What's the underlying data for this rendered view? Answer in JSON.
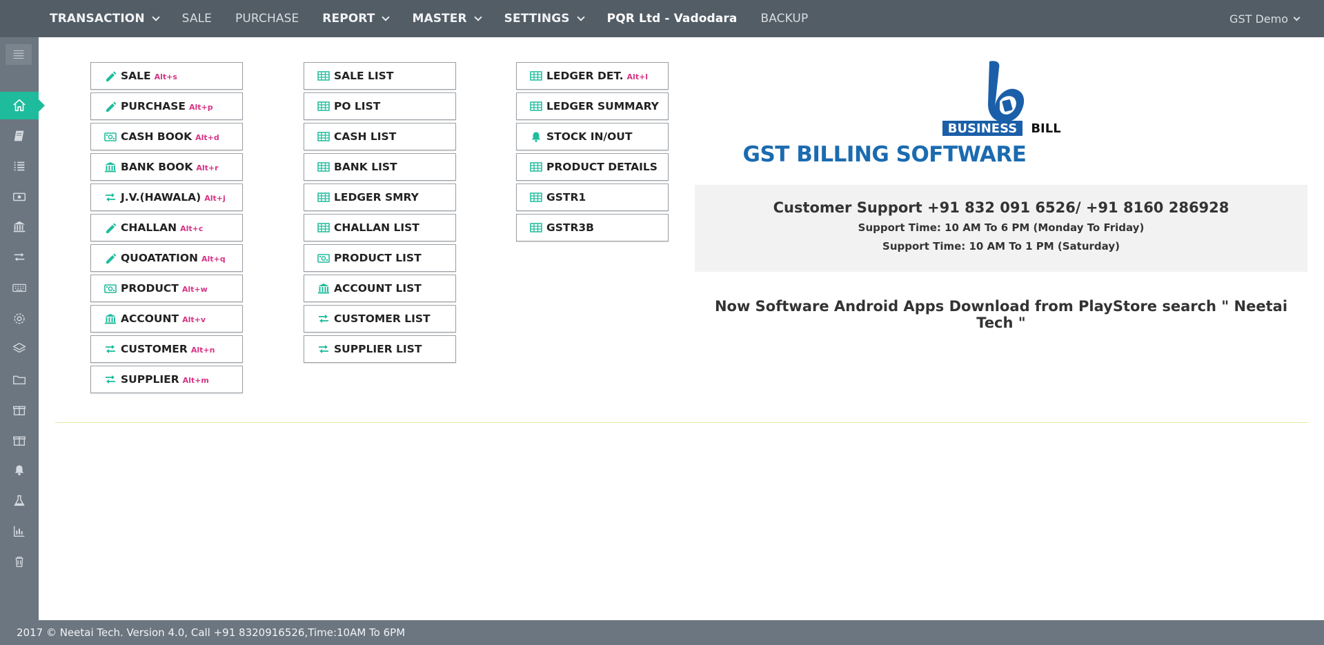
{
  "nav": {
    "items": [
      {
        "label": "TRANSACTION",
        "style": "bold",
        "dropdown": true
      },
      {
        "label": "SALE",
        "style": "light",
        "dropdown": false
      },
      {
        "label": "PURCHASE",
        "style": "light",
        "dropdown": false
      },
      {
        "label": "REPORT",
        "style": "bold",
        "dropdown": true
      },
      {
        "label": "MASTER",
        "style": "bold",
        "dropdown": true
      },
      {
        "label": "SETTINGS",
        "style": "bold",
        "dropdown": true
      },
      {
        "label": "PQR Ltd - Vadodara",
        "style": "brand",
        "dropdown": false
      },
      {
        "label": "BACKUP",
        "style": "light",
        "dropdown": false
      }
    ],
    "user": "GST Demo"
  },
  "sidebar": {
    "icons": [
      "menu-icon",
      "home-icon",
      "book-icon",
      "list-icon",
      "cash-icon",
      "bank-icon",
      "transfer-icon",
      "keyboard-icon",
      "gear-icon",
      "layers-icon",
      "folder-icon",
      "gift-icon",
      "gift-icon",
      "bell-icon",
      "flask-icon",
      "bar-chart-icon",
      "trash-icon"
    ],
    "active": "home-icon"
  },
  "columns": [
    [
      {
        "label": "SALE",
        "shortcut": "Alt+s",
        "icon": "pencil-icon"
      },
      {
        "label": "PURCHASE",
        "shortcut": "Alt+p",
        "icon": "pencil-icon"
      },
      {
        "label": "CASH BOOK",
        "shortcut": "Alt+d",
        "icon": "money-icon"
      },
      {
        "label": "BANK BOOK",
        "shortcut": "Alt+r",
        "icon": "bank-icon"
      },
      {
        "label": "J.V.(HAWALA)",
        "shortcut": "Alt+j",
        "icon": "exchange-icon"
      },
      {
        "label": "CHALLAN",
        "shortcut": "Alt+c",
        "icon": "pencil-icon"
      },
      {
        "label": "QUOATATION",
        "shortcut": "Alt+q",
        "icon": "pencil-icon"
      },
      {
        "label": "PRODUCT",
        "shortcut": "Alt+w",
        "icon": "money-icon"
      },
      {
        "label": "ACCOUNT",
        "shortcut": "Alt+v",
        "icon": "bank-icon"
      },
      {
        "label": "CUSTOMER",
        "shortcut": "Alt+n",
        "icon": "exchange-icon"
      },
      {
        "label": "SUPPLIER",
        "shortcut": "Alt+m",
        "icon": "exchange-icon"
      }
    ],
    [
      {
        "label": "SALE LIST",
        "shortcut": "",
        "icon": "table-icon"
      },
      {
        "label": "PO LIST",
        "shortcut": "",
        "icon": "table-icon"
      },
      {
        "label": "CASH LIST",
        "shortcut": "",
        "icon": "table-icon"
      },
      {
        "label": "BANK LIST",
        "shortcut": "",
        "icon": "table-icon"
      },
      {
        "label": "LEDGER SMRY",
        "shortcut": "",
        "icon": "table-icon"
      },
      {
        "label": "CHALLAN LIST",
        "shortcut": "",
        "icon": "table-icon"
      },
      {
        "label": "PRODUCT LIST",
        "shortcut": "",
        "icon": "money-icon"
      },
      {
        "label": "ACCOUNT LIST",
        "shortcut": "",
        "icon": "bank-icon"
      },
      {
        "label": "CUSTOMER LIST",
        "shortcut": "",
        "icon": "exchange-icon"
      },
      {
        "label": "SUPPLIER LIST",
        "shortcut": "",
        "icon": "exchange-icon"
      }
    ],
    [
      {
        "label": "LEDGER DET.",
        "shortcut": "Alt+l",
        "icon": "table-icon"
      },
      {
        "label": "LEDGER SUMMARY",
        "shortcut": "",
        "icon": "table-icon"
      },
      {
        "label": "STOCK IN/OUT",
        "shortcut": "",
        "icon": "bell-icon"
      },
      {
        "label": "PRODUCT DETAILS",
        "shortcut": "",
        "icon": "table-icon"
      },
      {
        "label": "GSTR1",
        "shortcut": "",
        "icon": "table-icon"
      },
      {
        "label": "GSTR3B",
        "shortcut": "",
        "icon": "table-icon"
      }
    ]
  ],
  "brand": {
    "logo_word1": "BUSINESS",
    "logo_word2": "BILL",
    "title": "GST BILLING SOFTWARE"
  },
  "support": {
    "line1": "Customer Support +91 832 091 6526/ +91 8160 286928",
    "line2": "Support Time: 10 AM To 6 PM (Monday To Friday)",
    "line3": "Support Time: 10 AM To 1 PM (Saturday)"
  },
  "android_note": "Now Software Android Apps Download from PlayStore search \" Neetai Tech \"",
  "footer": "2017 © Neetai Tech. Version 4.0, Call +91 8320916526,Time:10AM To 6PM",
  "colors": {
    "accent": "#1ebc9c",
    "shortcut": "#d63384",
    "title_blue": "#1b6bb0",
    "navbar": "#535d66",
    "sidebar": "#6c7680"
  }
}
